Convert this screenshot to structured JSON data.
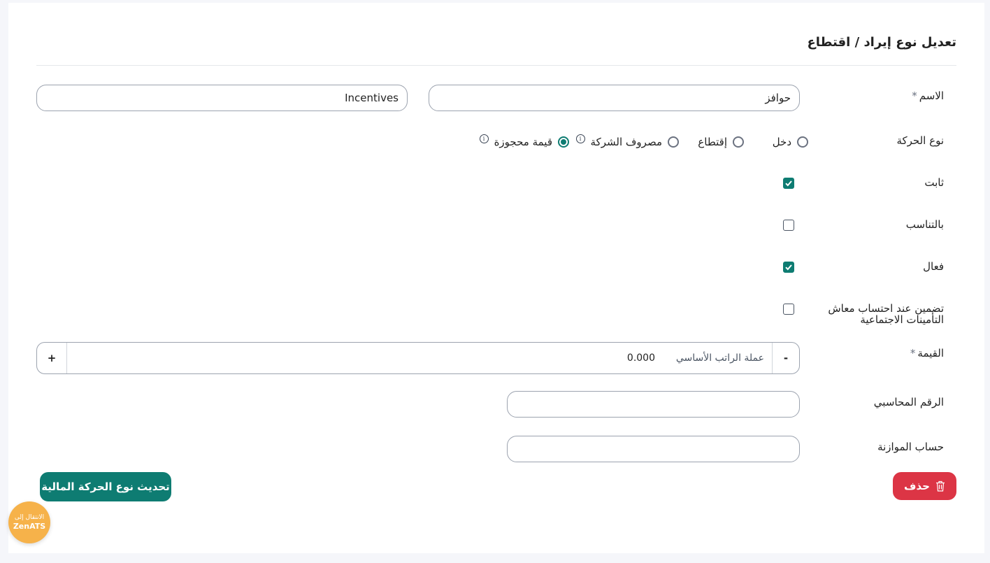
{
  "page": {
    "title": "تعديل نوع إيراد / اقتطاع"
  },
  "form": {
    "name": {
      "label": "الاسم",
      "required_mark": "*",
      "value_ar": "حوافز",
      "value_en": "Incentives"
    },
    "movement_type": {
      "label": "نوع الحركة",
      "options": [
        {
          "label": "دخل",
          "checked": false
        },
        {
          "label": "إقتطاع",
          "checked": false
        },
        {
          "label": "مصروف الشركة",
          "checked": false,
          "info": true
        },
        {
          "label": "قيمة محجوزة",
          "checked": true,
          "info": true
        }
      ]
    },
    "fixed": {
      "label": "ثابت",
      "checked": true
    },
    "proportional": {
      "label": "بالتناسب",
      "checked": false
    },
    "active": {
      "label": "فعال",
      "checked": true
    },
    "include_pension": {
      "label": "تضمين عند احتساب معاش التأمينات الاجتماعية",
      "checked": false
    },
    "value": {
      "label": "القيمة",
      "required_mark": "*",
      "minus": "-",
      "plus": "+",
      "currency": "عملة الراتب الأساسي",
      "amount": "0.000"
    },
    "account_number": {
      "label": "الرقم المحاسبي",
      "value": ""
    },
    "budget_account": {
      "label": "حساب الموازنة",
      "value": ""
    }
  },
  "actions": {
    "update_label": "تحديث نوع الحركة المالية",
    "delete_label": "حذف"
  },
  "zen_badge": {
    "line1": "الانتقال إلى",
    "line2": "ZenATS"
  },
  "colors": {
    "primary": "#0e7c72",
    "danger": "#dc3545",
    "badge": "#f6b24a"
  }
}
